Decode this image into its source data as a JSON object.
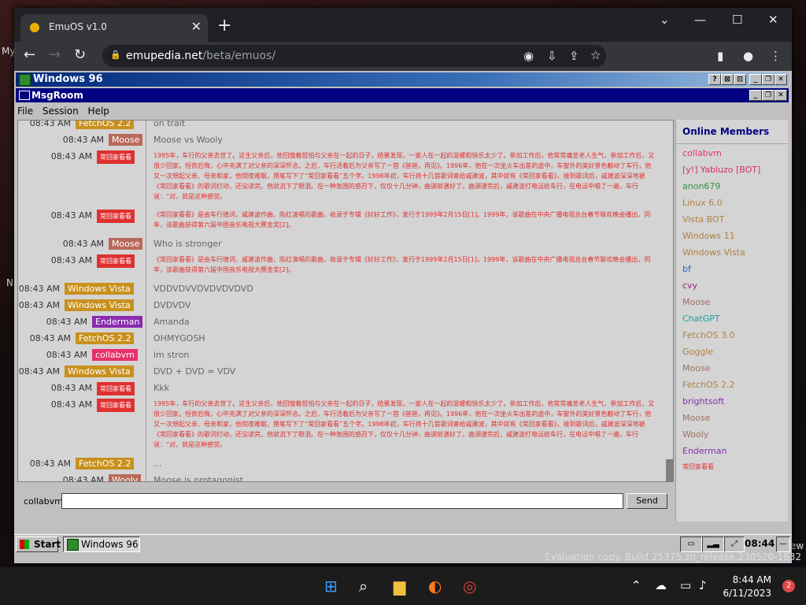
{
  "desktop": {
    "left_label_1": "My",
    "left_label_2": "N",
    "right_label": "ew"
  },
  "browser": {
    "tab_title": "EmuOS v1.0",
    "tab_close": "✕",
    "new_tab": "+",
    "url_host": "emupedia.net",
    "url_path": "/beta/emuos/",
    "win_min": "—",
    "win_max": "☐",
    "win_close": "✕",
    "tabs_dropdown": "⌄"
  },
  "w96": {
    "title": "Windows 96",
    "msgroom_title": "MsgRoom",
    "menu": [
      "File",
      "Session",
      "Help"
    ],
    "title_buttons": [
      "?",
      "⊠",
      "⊡",
      "_",
      "❐",
      "✕"
    ],
    "msg_buttons": [
      "_",
      "❐",
      "✕"
    ]
  },
  "chat": [
    {
      "time": "08:43 AM",
      "user": "FetchOS 2.2",
      "color": "#c8901c",
      "text": "on trait"
    },
    {
      "time": "08:43 AM",
      "user": "Moose",
      "color": "#b86a5a",
      "text": "Moose vs Wooly"
    },
    {
      "time": "08:43 AM",
      "user": "常回家看看",
      "color": "#e03030",
      "text": "1995年，车行的父亲去世了。这生父亲后，他回憶着怨怕与父亲在一起的日子，结果发现，一家人在一起的温暖和快乐太少了。参加工作后，他常常痛苦老人生气，参加工作后，又很少回家。恒依后悔，心中充满了对父亲的深深怀念。之后，车行活着后为父亲写了一首《爸爸，再见》。1996年，他在一次坐火车出差的途中，车窗外的美好景色触动了车行，他又一次想起父亲、母亲和家，他彻夜难眠，用笔写下了“常回家看看”五个字。1998年初，车行将十几首歌词寄给戚建波，其中就有《常回家看看》，接到歌词后，戚建波深深地被《常回家看看》的歌词打动，还没读完，他就流下了眼泪。在一种氛围的感召下，仅仅十几分钟，曲调就谱好了。曲调谱完后，戚建波打电话给车行，在电话中唱了一遍，车行说：“对，就是这种感觉。",
      "small": true,
      "lines": 5
    },
    {
      "time": "08:43 AM",
      "user": "常回家看看",
      "color": "#e03030",
      "text": "《常回家看看》是由车行填词，戚建波作曲，陈红演唱的歌曲，收录于专辑《好好工作》，发行于1999年2月15日[1]。1999年，该歌曲在中央广播电视总台春节联欢晚会播出，同年，该歌曲获得第六届中国音乐电视大赛金奖[2]。",
      "small": true,
      "lines": 2
    },
    {
      "time": "08:43 AM",
      "user": "Moose",
      "color": "#b86a5a",
      "text": "Who is stronger"
    },
    {
      "time": "08:43 AM",
      "user": "常回家看看",
      "color": "#e03030",
      "text": "《常回家看看》是由车行填词，戚建波作曲，陈红演唱的歌曲，收录于专辑《好好工作》，发行于1999年2月15日[1]。1999年，该歌曲在中央广播电视总台春节联欢晚会播出，同年，该歌曲获得第六届中国音乐电视大赛金奖[2]。",
      "small": true,
      "lines": 2
    },
    {
      "time": "08:43 AM",
      "user": "Windows Vista",
      "color": "#c8901c",
      "text": "VDDVDVVDVDVDVDVD"
    },
    {
      "time": "08:43 AM",
      "user": "Windows Vista",
      "color": "#c8901c",
      "text": "DVDVDV"
    },
    {
      "time": "08:43 AM",
      "user": "Enderman",
      "color": "#8a2bb0",
      "text": "Amanda"
    },
    {
      "time": "08:43 AM",
      "user": "FetchOS 2.2",
      "color": "#c8901c",
      "text": "OHMYGOSH"
    },
    {
      "time": "08:43 AM",
      "user": "collabvm",
      "color": "#e8306a",
      "text": "im stron"
    },
    {
      "time": "08:43 AM",
      "user": "Windows Vista",
      "color": "#c8901c",
      "text": "DVD + DVD = VDV"
    },
    {
      "time": "08:43 AM",
      "user": "常回家看看",
      "color": "#e03030",
      "text": "Kkk"
    },
    {
      "time": "08:43 AM",
      "user": "常回家看看",
      "color": "#e03030",
      "text": "1995年，车行的父亲去世了。这生父亲后，他回憶着怨怕与父亲在一起的日子，结果发现，一家人在一起的温暖和快乐太少了。参加工作后，他常常痛苦老人生气，参加工作后，又很少回家。恒依后悔，心中充满了对父亲的深深怀念。之后，车行活着后为父亲写了一首《爸爸，再见》。1996年，他在一次坐火车出差的途中，车窗外的美好景色触动了车行，他又一次想起父亲、母亲和家，他彻夜难眠，用笔写下了“常回家看看”五个字。1998年初，车行将十几首歌词寄给戚建波，其中就有《常回家看看》，接到歌词后，戚建波深深地被《常回家看看》的歌词打动，还没读完，他就流下了眼泪。在一种氛围的感召下，仅仅十几分钟，曲调就谱好了。曲调谱完后，戚建波打电话给车行，在电话中唱了一遍，车行说：“对，就是这种感觉。",
      "small": true,
      "lines": 5
    },
    {
      "time": "08:43 AM",
      "user": "FetchOS 2.2",
      "color": "#c8901c",
      "text": "..."
    },
    {
      "time": "08:43 AM",
      "user": "Wooly",
      "color": "#b86a5a",
      "text": "Moose is protagonist"
    }
  ],
  "members_header": "Online Members",
  "members": [
    {
      "name": "collabvm",
      "color": "#e8306a"
    },
    {
      "name": "[y!] Yabluzo [BOT]",
      "color": "#d0306a"
    },
    {
      "name": "anon679",
      "color": "#309040"
    },
    {
      "name": "Linux 6.0",
      "color": "#b08040"
    },
    {
      "name": "Vista BOT",
      "color": "#b08040"
    },
    {
      "name": "Windows 11",
      "color": "#b08040"
    },
    {
      "name": "Windows Vista",
      "color": "#b08040"
    },
    {
      "name": "bf",
      "color": "#3060c0"
    },
    {
      "name": "cvy",
      "color": "#a02080"
    },
    {
      "name": "Moose",
      "color": "#a07060"
    },
    {
      "name": "ChatGPT",
      "color": "#20a0a0"
    },
    {
      "name": "FetchOS 3.0",
      "color": "#b08040"
    },
    {
      "name": "Goggle",
      "color": "#b08040"
    },
    {
      "name": "Moose",
      "color": "#a07060"
    },
    {
      "name": "FetchOS 2.2",
      "color": "#b08040"
    },
    {
      "name": "brightsoft",
      "color": "#8030b0"
    },
    {
      "name": "Moose",
      "color": "#a07060"
    },
    {
      "name": "Wooly",
      "color": "#a07060"
    },
    {
      "name": "Enderman",
      "color": "#8030b0"
    },
    {
      "name": "常回家看看",
      "color": "#e03030"
    }
  ],
  "input": {
    "user": "collabvm",
    "value": "",
    "send": "Send"
  },
  "taskbar96": {
    "start": "Start",
    "active": "Windows 96",
    "clock": "08:44"
  },
  "system": {
    "eval_text": "Evaluation copy. Build 25375.zn_release.230520-1632",
    "time": "8:44 AM",
    "date": "6/11/2023",
    "notif": "2"
  }
}
